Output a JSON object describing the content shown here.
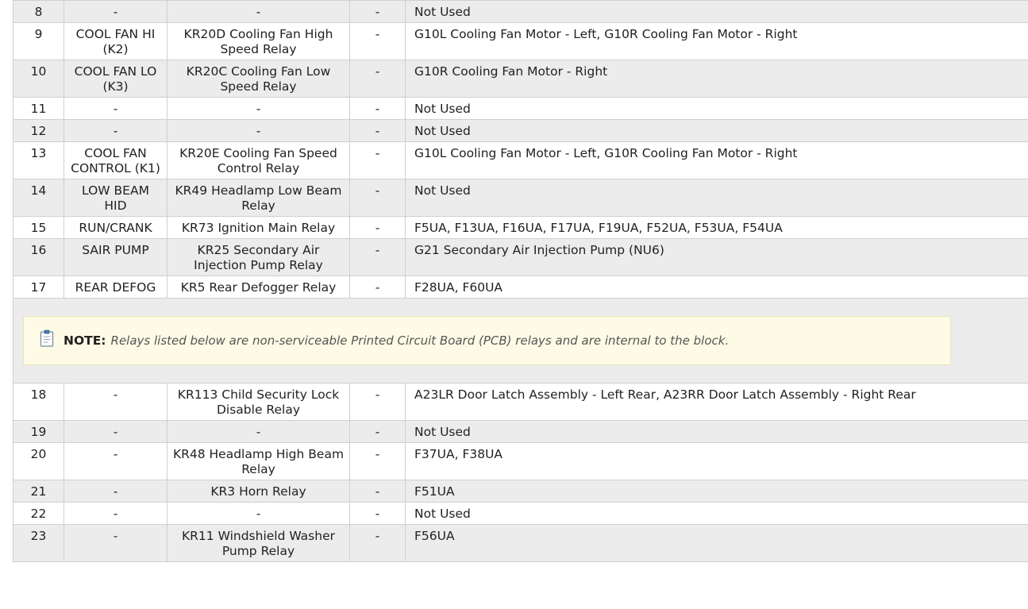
{
  "rows_top": [
    {
      "num": "8",
      "name": "-",
      "relay": "-",
      "misc": "-",
      "circuit": "Not Used"
    },
    {
      "num": "9",
      "name": "COOL FAN HI (K2)",
      "relay": "KR20D Cooling Fan High Speed Relay",
      "misc": "-",
      "circuit": "G10L Cooling Fan Motor - Left, G10R Cooling Fan Motor - Right"
    },
    {
      "num": "10",
      "name": "COOL FAN LO (K3)",
      "relay": "KR20C Cooling Fan Low Speed Relay",
      "misc": "-",
      "circuit": "G10R Cooling Fan Motor - Right"
    },
    {
      "num": "11",
      "name": "-",
      "relay": "-",
      "misc": "-",
      "circuit": "Not Used"
    },
    {
      "num": "12",
      "name": "-",
      "relay": "-",
      "misc": "-",
      "circuit": "Not Used"
    },
    {
      "num": "13",
      "name": "COOL FAN CONTROL (K1)",
      "relay": "KR20E Cooling Fan Speed Control Relay",
      "misc": "-",
      "circuit": "G10L Cooling Fan Motor - Left, G10R Cooling Fan Motor - Right"
    },
    {
      "num": "14",
      "name": "LOW BEAM HID",
      "relay": "KR49 Headlamp Low Beam Relay",
      "misc": "-",
      "circuit": "Not Used"
    },
    {
      "num": "15",
      "name": "RUN/CRANK",
      "relay": "KR73 Ignition Main Relay",
      "misc": "-",
      "circuit": "F5UA, F13UA, F16UA, F17UA, F19UA, F52UA, F53UA, F54UA"
    },
    {
      "num": "16",
      "name": "SAIR PUMP",
      "relay": "KR25 Secondary Air Injection Pump Relay",
      "misc": "-",
      "circuit": "G21 Secondary Air Injection Pump (NU6)"
    },
    {
      "num": "17",
      "name": "REAR DEFOG",
      "relay": "KR5 Rear Defogger Relay",
      "misc": "-",
      "circuit": "F28UA, F60UA"
    }
  ],
  "note": {
    "icon": "clipboard-note-icon",
    "label": "NOTE:",
    "text": "Relays listed below are non-serviceable Printed Circuit Board (PCB) relays and are internal to the block."
  },
  "rows_bottom": [
    {
      "num": "18",
      "name": "-",
      "relay": "KR113 Child Security Lock Disable Relay",
      "misc": "-",
      "circuit": "A23LR Door Latch Assembly - Left Rear, A23RR Door Latch Assembly - Right Rear"
    },
    {
      "num": "19",
      "name": "-",
      "relay": "-",
      "misc": "-",
      "circuit": "Not Used"
    },
    {
      "num": "20",
      "name": "-",
      "relay": "KR48 Headlamp High Beam Relay",
      "misc": "-",
      "circuit": "F37UA, F38UA"
    },
    {
      "num": "21",
      "name": "-",
      "relay": "KR3 Horn Relay",
      "misc": "-",
      "circuit": "F51UA"
    },
    {
      "num": "22",
      "name": "-",
      "relay": "-",
      "misc": "-",
      "circuit": "Not Used"
    },
    {
      "num": "23",
      "name": "-",
      "relay": "KR11 Windshield Washer Pump Relay",
      "misc": "-",
      "circuit": "F56UA"
    }
  ]
}
